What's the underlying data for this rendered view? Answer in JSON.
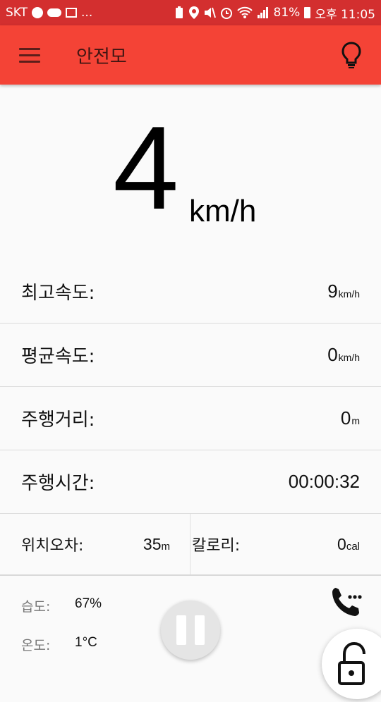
{
  "status_bar": {
    "carrier": "SKT",
    "overflow": "...",
    "battery": "81%",
    "time": "오후 11:05"
  },
  "toolbar": {
    "title": "안전모",
    "menu_icon": "hamburger-menu-icon",
    "light_icon": "lightbulb-icon",
    "color": "#f44336"
  },
  "speed": {
    "value": "4",
    "unit": "km/h"
  },
  "stats": [
    {
      "label": "최고속도:",
      "value": "9",
      "unit": "km/h"
    },
    {
      "label": "평균속도:",
      "value": "0",
      "unit": "km/h"
    },
    {
      "label": "주행거리:",
      "value": "0",
      "unit": "m"
    },
    {
      "label": "주행시간:",
      "value": "00:00:32",
      "unit": ""
    }
  ],
  "position_error": {
    "label": "위치오차:",
    "value": "35",
    "unit": "m"
  },
  "calories": {
    "label": "칼로리:",
    "value": "0",
    "unit": "cal"
  },
  "environment": {
    "humidity": {
      "label": "습도:",
      "value": "67%"
    },
    "temperature": {
      "label": "온도:",
      "value": "1°C"
    }
  },
  "buttons": {
    "pause_icon": "pause-icon",
    "call_icon": "phone-call-icon",
    "lock_icon": "unlocked-padlock-icon"
  }
}
